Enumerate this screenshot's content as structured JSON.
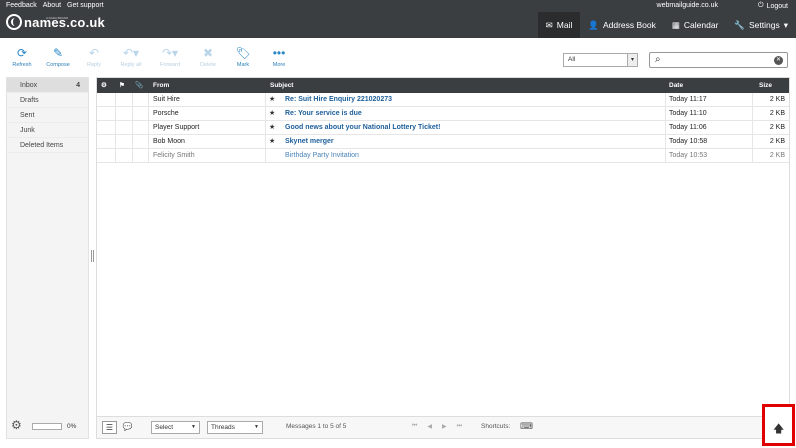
{
  "topbar": {
    "links": [
      "Feedback",
      "About",
      "Get support"
    ],
    "account": "webmailguide.co.uk",
    "logout": "Logout",
    "logo_text": "names.co.uk",
    "logo_sub": "A DADA BRAND",
    "nav": [
      {
        "label": "Mail",
        "icon": "envelope-icon",
        "active": true
      },
      {
        "label": "Address Book",
        "icon": "person-icon",
        "active": false
      },
      {
        "label": "Calendar",
        "icon": "calendar-icon",
        "active": false
      },
      {
        "label": "Settings",
        "icon": "wrench-icon",
        "active": false
      }
    ]
  },
  "toolbar": {
    "refresh": "Refresh",
    "compose": "Compose",
    "reply": "Reply",
    "reply_all": "Reply all",
    "forward": "Forward",
    "delete": "Delete",
    "mark": "Mark",
    "more": "More"
  },
  "filter": {
    "value": "All"
  },
  "search": {
    "placeholder": ""
  },
  "folders": [
    {
      "name": "Inbox",
      "count": "4"
    },
    {
      "name": "Drafts",
      "count": ""
    },
    {
      "name": "Sent",
      "count": ""
    },
    {
      "name": "Junk",
      "count": ""
    },
    {
      "name": "Deleted Items",
      "count": ""
    }
  ],
  "quota": {
    "text": "0%",
    "fraction": 0
  },
  "list": {
    "headers": {
      "from": "From",
      "subject": "Subject",
      "date": "Date",
      "size": "Size"
    },
    "messages": [
      {
        "from": "Suit Hire",
        "subject": "Re: Suit Hire Enquiry 221020273",
        "date": "Today 11:17",
        "size": "2 KB",
        "unread": true,
        "flag": "★"
      },
      {
        "from": "Porsche",
        "subject": "Re: Your service is due",
        "date": "Today 11:10",
        "size": "2 KB",
        "unread": true,
        "flag": "★"
      },
      {
        "from": "Player Support",
        "subject": "Good news about your National Lottery Ticket!",
        "date": "Today 11:06",
        "size": "2 KB",
        "unread": true,
        "flag": "★"
      },
      {
        "from": "Bob Moon",
        "subject": "Skynet merger",
        "date": "Today 10:58",
        "size": "2 KB",
        "unread": true,
        "flag": "★"
      },
      {
        "from": "Felicity Smith",
        "subject": "Birthday Party Invitation",
        "date": "Today 10:53",
        "size": "2 KB",
        "unread": false,
        "flag": ""
      }
    ]
  },
  "footer": {
    "select": "Select",
    "threads": "Threads",
    "count_text": "Messages 1 to 5 of 5",
    "shortcuts": "Shortcuts:"
  }
}
